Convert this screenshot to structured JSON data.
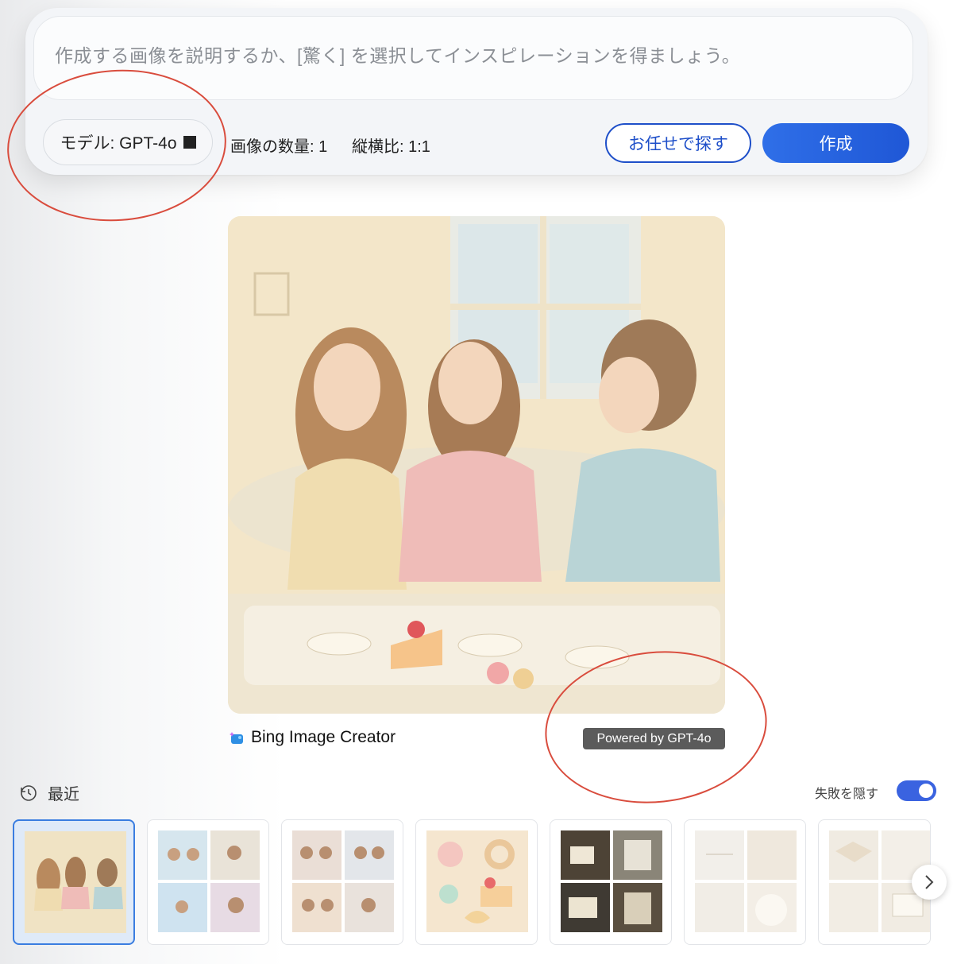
{
  "prompt": {
    "placeholder": "作成する画像を説明するか、[驚く] を選択してインスピレーションを得ましょう。"
  },
  "options": {
    "model_label": "モデル: GPT-4o",
    "count_label": "画像の数量: 1",
    "ratio_label": "縦横比: 1:1"
  },
  "buttons": {
    "surprise_label": "お任せで探す",
    "create_label": "作成"
  },
  "result": {
    "brand_label": "Bing Image Creator",
    "powered_label": "Powered by GPT-4o"
  },
  "history": {
    "recent_label": "最近",
    "hide_failed_label": "失敗を隠す",
    "hide_failed_on": true
  },
  "colors": {
    "accent": "#1e4fc9",
    "annotation": "#d94c3d",
    "toggle": "#3a63e0"
  }
}
